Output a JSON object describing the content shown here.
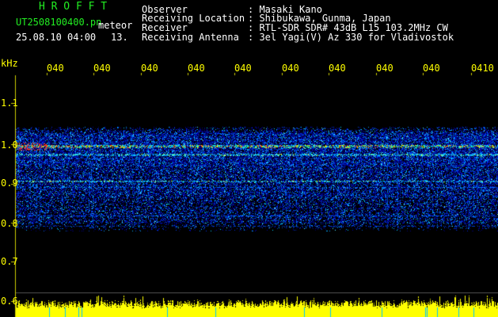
{
  "header": {
    "brand": "H R O F F T",
    "filename": "UT2508100400.pn",
    "mode": "meteor",
    "datetime": "25.08.10 04:00",
    "count": "13."
  },
  "info": {
    "labels": [
      "Observer",
      "Receiving Location",
      "Receiver",
      "Receiving Antenna"
    ],
    "values": [
      ": Masaki Kano",
      ": Shibukawa, Gunma, Japan",
      ": RTL-SDR SDR# 43dB L15 103.2MHz CW",
      ": 3el Yagi(V) Az 330 for Vladivostok"
    ]
  },
  "axis": {
    "unit": "kHz",
    "y_ticks": [
      "1.1",
      "1.0",
      "0.9",
      "0.8",
      "0.7",
      "0.6"
    ],
    "time_ticks": [
      "040",
      "040",
      "040",
      "040",
      "040",
      "040",
      "040",
      "040",
      "040",
      "0410"
    ]
  },
  "colors": {
    "background": "#000000",
    "text_green": "#22ee22",
    "text_white": "#ffffff",
    "text_yellow": "#ffff00",
    "band_blue": "#1030ff",
    "baseline_yellow": "#ffff00"
  }
}
